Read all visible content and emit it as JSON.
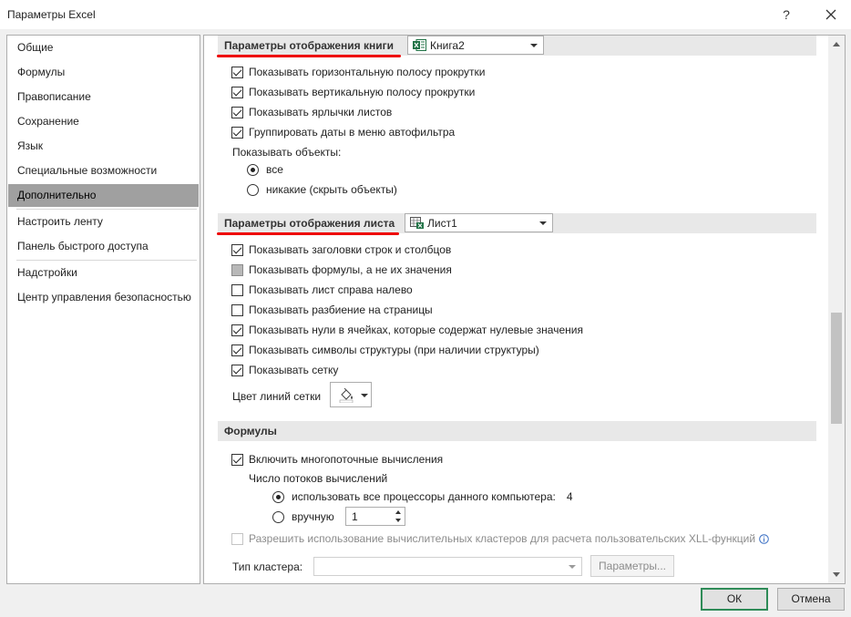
{
  "window": {
    "title": "Параметры Excel",
    "help": "?"
  },
  "sidebar": {
    "items": [
      {
        "label": "Общие"
      },
      {
        "label": "Формулы"
      },
      {
        "label": "Правописание"
      },
      {
        "label": "Сохранение"
      },
      {
        "label": "Язык"
      },
      {
        "label": "Специальные возможности"
      },
      {
        "label": "Дополнительно",
        "selected": true
      },
      {
        "label": "Настроить ленту"
      },
      {
        "label": "Панель быстрого доступа"
      },
      {
        "label": "Надстройки"
      },
      {
        "label": "Центр управления безопасностью"
      }
    ]
  },
  "book_section": {
    "title": "Параметры отображения книги",
    "workbook": "Книга2",
    "options": [
      {
        "label": "Показывать горизонтальную полосу прокрутки",
        "checked": true
      },
      {
        "label": "Показывать вертикальную полосу прокрутки",
        "checked": true
      },
      {
        "label": "Показывать ярлычки листов",
        "checked": true
      },
      {
        "label": "Группировать даты в меню автофильтра",
        "checked": true
      }
    ],
    "objects_label": "Показывать объекты:",
    "objects_all": "все",
    "objects_none": "никакие (скрыть объекты)"
  },
  "sheet_section": {
    "title": "Параметры отображения листа",
    "sheet": "Лист1",
    "options": [
      {
        "label": "Показывать заголовки строк и столбцов",
        "state": "checked"
      },
      {
        "label": "Показывать формулы, а не их значения",
        "state": "indeterminate"
      },
      {
        "label": "Показывать лист справа налево",
        "state": "unchecked"
      },
      {
        "label": "Показывать разбиение на страницы",
        "state": "unchecked"
      },
      {
        "label": "Показывать нули в ячейках, которые содержат нулевые значения",
        "state": "checked"
      },
      {
        "label": "Показывать символы структуры (при наличии структуры)",
        "state": "checked"
      },
      {
        "label": "Показывать сетку",
        "state": "checked"
      }
    ],
    "gridline_color_label": "Цвет линий сетки"
  },
  "formulas_section": {
    "title": "Формулы",
    "multithread_label": "Включить многопоточные вычисления",
    "threads_label": "Число потоков вычислений",
    "use_all_label": "использовать все процессоры данного компьютера:",
    "processor_count": "4",
    "manual_label": "вручную",
    "manual_value": "1",
    "cluster_label": "Разрешить использование вычислительных кластеров для расчета пользовательских XLL-функций",
    "cluster_type_label": "Тип кластера:",
    "params_button": "Параметры..."
  },
  "footer": {
    "ok": "ОК",
    "cancel": "Отмена"
  },
  "colors": {
    "selected_nav": "#a0a0a0",
    "annotation_underline": "#e00000",
    "excel_green": "#217346",
    "ok_border": "#2e8b57"
  }
}
